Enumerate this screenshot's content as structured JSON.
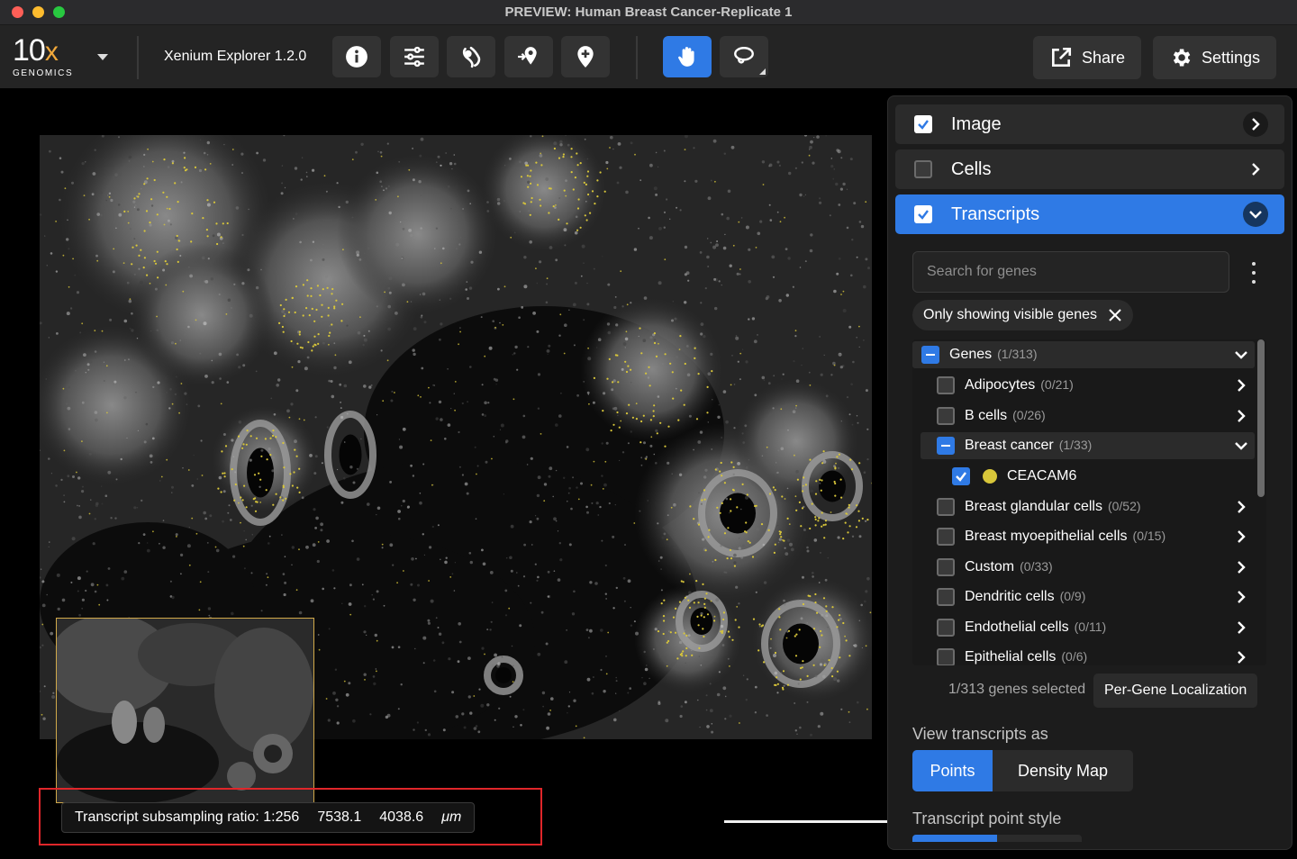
{
  "window": {
    "title": "PREVIEW: Human Breast Cancer-Replicate 1"
  },
  "logo": {
    "brand": "10x",
    "sub": "GENOMICS"
  },
  "toolbar": {
    "app_name": "Xenium Explorer 1.2.0",
    "share_label": "Share",
    "settings_label": "Settings",
    "icons": [
      "info-icon",
      "sliders-icon",
      "gene-panel-icon",
      "add-location-icon",
      "map-pin-icon",
      "hand-pan-icon",
      "lasso-icon"
    ],
    "active_tool": "hand-pan-icon"
  },
  "status": {
    "subsampling": "Transcript subsampling ratio: 1:256",
    "x": "7538.1",
    "y": "4038.6",
    "unit": "μm"
  },
  "layers": [
    {
      "label": "Image",
      "checked": true
    },
    {
      "label": "Cells",
      "checked": false
    },
    {
      "label": "Transcripts",
      "checked": true
    }
  ],
  "transcripts": {
    "search_placeholder": "Search for genes",
    "filter_chip": "Only showing visible genes",
    "tree": [
      {
        "name": "Genes",
        "count": "(1/313)",
        "state": "partial",
        "expanded": true
      },
      {
        "name": "Adipocytes",
        "count": "(0/21)",
        "state": "off"
      },
      {
        "name": "B cells",
        "count": "(0/26)",
        "state": "off"
      },
      {
        "name": "Breast cancer",
        "count": "(1/33)",
        "state": "partial",
        "expanded": true
      },
      {
        "name": "CEACAM6",
        "count": "",
        "state": "on",
        "color": "#d8c63a"
      },
      {
        "name": "Breast glandular cells",
        "count": "(0/52)",
        "state": "off"
      },
      {
        "name": "Breast myoepithelial cells",
        "count": "(0/15)",
        "state": "off"
      },
      {
        "name": "Custom",
        "count": "(0/33)",
        "state": "off"
      },
      {
        "name": "Dendritic cells",
        "count": "(0/9)",
        "state": "off"
      },
      {
        "name": "Endothelial cells",
        "count": "(0/11)",
        "state": "off"
      },
      {
        "name": "Epithelial cells",
        "count": "(0/6)",
        "state": "off"
      }
    ],
    "selected_count": "1/313 genes selected",
    "per_gene_button": "Per-Gene Localization",
    "view_as_label": "View transcripts as",
    "view_as_options": [
      "Points",
      "Density Map"
    ],
    "view_as_selected": "Points",
    "point_style_label": "Transcript point style"
  },
  "colors": {
    "accent": "#2f7ae5",
    "transcript_point": "#d8c63a",
    "highlight_box": "#e0262a",
    "minimap_border": "#d1a94a"
  }
}
